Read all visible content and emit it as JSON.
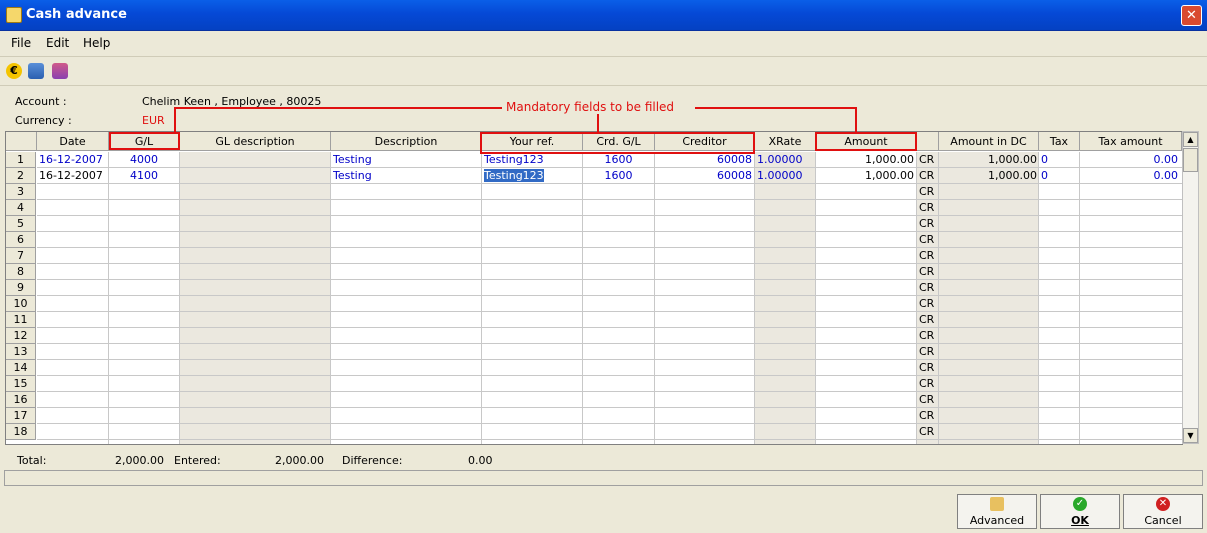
{
  "window": {
    "title": "Cash advance",
    "close_symbol": "✕"
  },
  "menu": [
    "File",
    "Edit",
    "Help"
  ],
  "toolbar": {
    "icons": [
      "currency-icon",
      "process-icon",
      "book-icon"
    ],
    "currency_symbol": "€"
  },
  "header": {
    "account_label": "Account :",
    "account_value": "Chelim Keen , Employee , 80025",
    "currency_label": "Currency :",
    "currency_value": "EUR"
  },
  "annotation": {
    "text": "Mandatory fields to be filled",
    "color": "#e01010"
  },
  "grid": {
    "columns": [
      "Date",
      "G/L",
      "GL description",
      "Description",
      "Your ref.",
      "Crd. G/L",
      "Creditor",
      "XRate",
      "Amount",
      "",
      "Amount in DC",
      "Tax",
      "Tax amount"
    ],
    "rows": [
      {
        "num": "1",
        "date": "16-12-2007",
        "gl": "4000",
        "gl_desc": "",
        "description": "Testing",
        "your_ref": "Testing123",
        "crd_gl": "1600",
        "creditor": "60008",
        "xrate": "1.00000",
        "amount": "1,000.00",
        "dc": "CR",
        "amount_dc": "1,000.00",
        "tax": "0",
        "tax_amount": "0.00"
      },
      {
        "num": "2",
        "date": "16-12-2007",
        "gl": "4100",
        "gl_desc": "",
        "description": "Testing",
        "your_ref": "Testing123",
        "crd_gl": "1600",
        "creditor": "60008",
        "xrate": "1.00000",
        "amount": "1,000.00",
        "dc": "CR",
        "amount_dc": "1,000.00",
        "tax": "0",
        "tax_amount": "0.00"
      }
    ],
    "empty_row_numbers": [
      "3",
      "4",
      "5",
      "6",
      "7",
      "8",
      "9",
      "10",
      "11",
      "12",
      "13",
      "14",
      "15",
      "16",
      "17",
      "18"
    ],
    "empty_dc": "CR"
  },
  "totals": {
    "total_label": "Total:",
    "total_value": "2,000.00",
    "entered_label": "Entered:",
    "entered_value": "2,000.00",
    "difference_label": "Difference:",
    "difference_value": "0.00"
  },
  "buttons": {
    "advanced": "Advanced",
    "ok": "OK",
    "cancel": "Cancel"
  },
  "colors": {
    "accent_blue": "#0000c8",
    "title_bar": "#0549d6",
    "mandatory_red": "#e01010"
  }
}
